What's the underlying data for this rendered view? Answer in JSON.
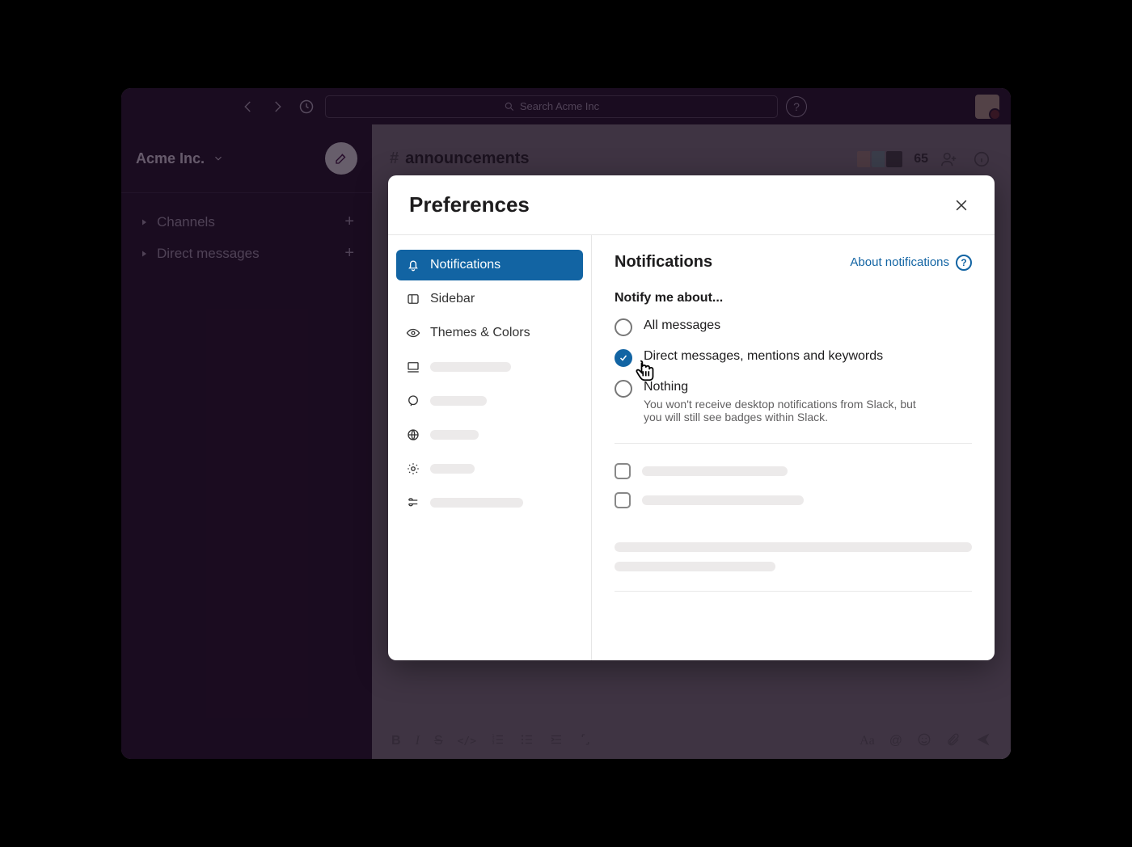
{
  "topbar": {
    "search_placeholder": "Search Acme Inc"
  },
  "workspace": {
    "name": "Acme Inc."
  },
  "sidebar": {
    "channels_label": "Channels",
    "dms_label": "Direct messages"
  },
  "channel": {
    "name": "announcements",
    "member_count": "65"
  },
  "modal": {
    "title": "Preferences",
    "nav": {
      "notifications": "Notifications",
      "sidebar": "Sidebar",
      "themes": "Themes & Colors"
    },
    "content": {
      "heading": "Notifications",
      "about_link": "About notifications",
      "notify_label": "Notify me about...",
      "option_all": "All messages",
      "option_dm": "Direct messages, mentions and keywords",
      "option_nothing": "Nothing",
      "nothing_note": "You won't receive desktop notifications from Slack, but you will still see badges within Slack."
    }
  }
}
